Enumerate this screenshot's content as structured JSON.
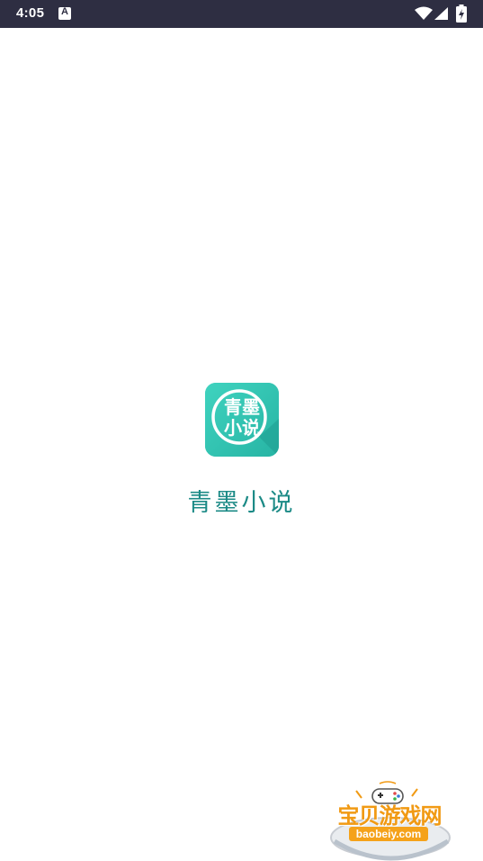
{
  "status_bar": {
    "time": "4:05",
    "notification_icon_letter": "A",
    "background": "#2e2e42",
    "icons": [
      "wifi-icon",
      "signal-icon",
      "battery-icon"
    ]
  },
  "splash": {
    "app_icon_text": "青墨\n小说",
    "app_name": "青墨小说",
    "icon_color": "#34c8b6",
    "name_color": "#1b8a86"
  },
  "watermark": {
    "title": "宝贝游戏网",
    "url": "baobeiy.com",
    "icon": "gamepad-icon",
    "color": "#f19a14"
  }
}
